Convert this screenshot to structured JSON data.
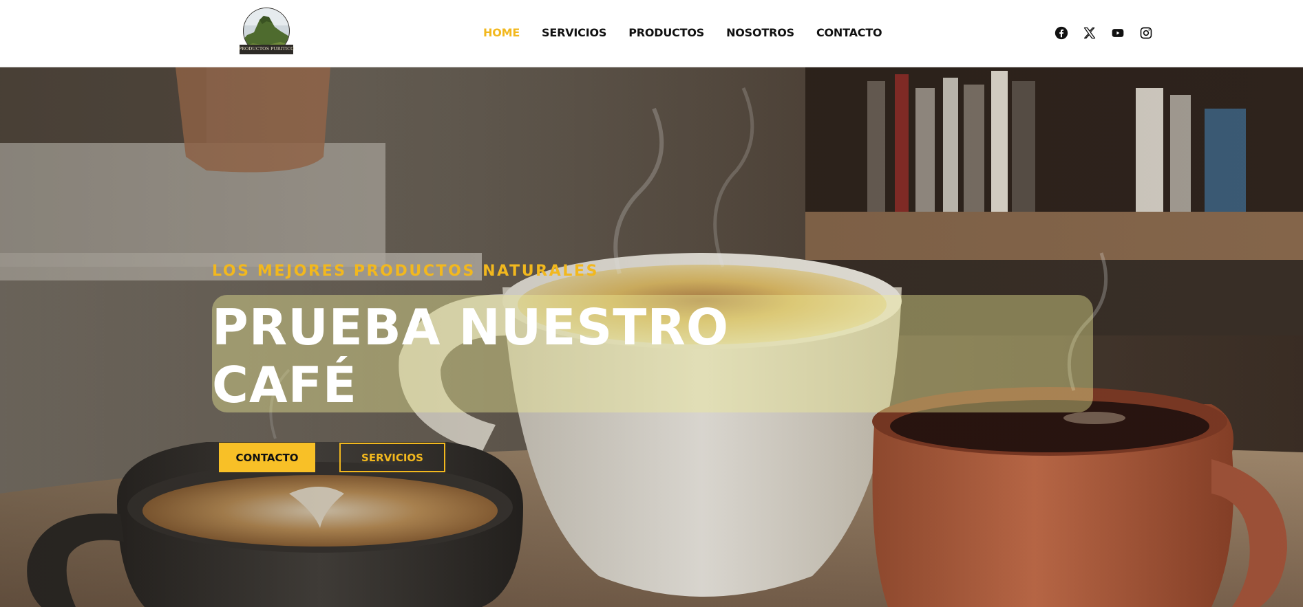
{
  "header": {
    "logo": {
      "text": "PRODUCTOS PURITICO",
      "icon": "mountain-logo"
    },
    "nav": [
      {
        "label": "HOME",
        "active": true
      },
      {
        "label": "SERVICIOS",
        "active": false
      },
      {
        "label": "PRODUCTOS",
        "active": false
      },
      {
        "label": "NOSOTROS",
        "active": false
      },
      {
        "label": "CONTACTO",
        "active": false
      }
    ],
    "social": [
      {
        "icon": "facebook-icon"
      },
      {
        "icon": "x-twitter-icon"
      },
      {
        "icon": "youtube-icon"
      },
      {
        "icon": "instagram-icon"
      }
    ]
  },
  "hero": {
    "eyebrow": "LOS MEJORES PRODUCTOS NATURALES",
    "headline": "PRUEBA NUESTRO CAFÉ",
    "buttons": {
      "primary": "CONTACTO",
      "secondary": "SERVICIOS"
    },
    "background": "coffee-cups-photo"
  },
  "colors": {
    "accent": "#f2b81e",
    "button": "#f8c027",
    "text_dark": "#111111",
    "header_bg": "#ffffff"
  }
}
